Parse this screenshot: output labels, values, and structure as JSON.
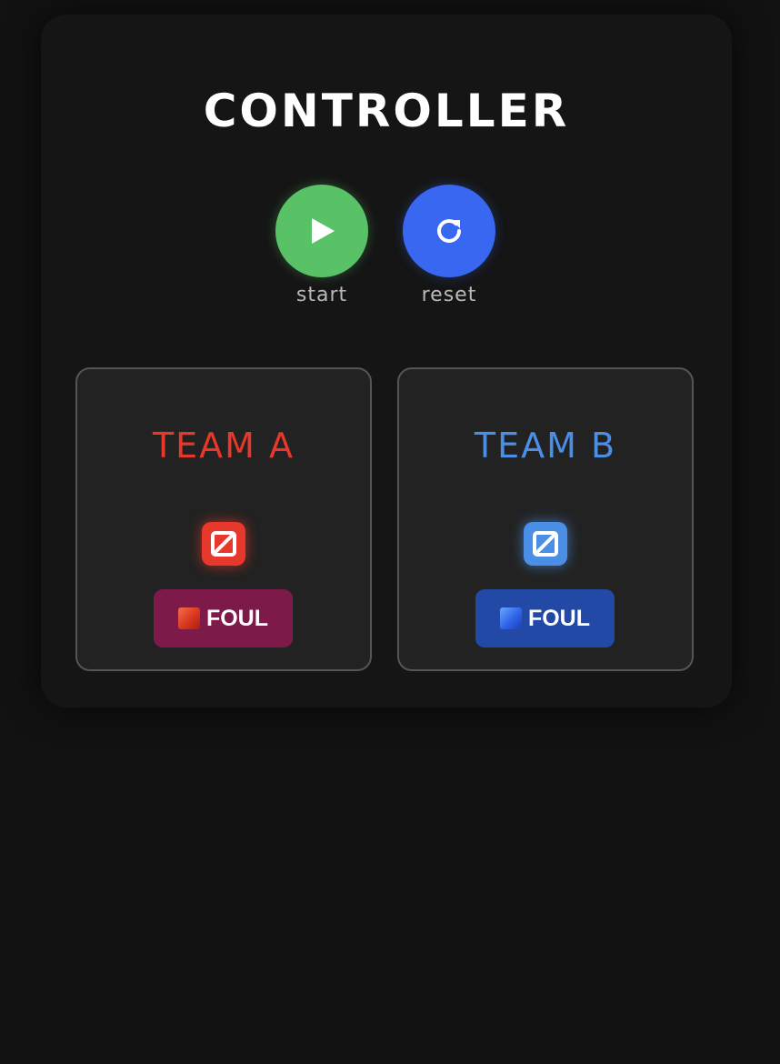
{
  "app": {
    "title": "CONTROLLER"
  },
  "controls": {
    "start": {
      "label": "start",
      "icon": "play-icon",
      "color": "#59c266"
    },
    "reset": {
      "label": "reset",
      "icon": "refresh-icon",
      "color": "#3867f2"
    }
  },
  "teams": [
    {
      "name": "TEAM A",
      "score": "0",
      "color": "#e8372b",
      "foul_label": "FOUL",
      "foul_icon": "red-square-icon",
      "foul_button_color": "#7d1a49"
    },
    {
      "name": "TEAM B",
      "score": "0",
      "color": "#4a8ee6",
      "foul_label": "FOUL",
      "foul_icon": "blue-square-icon",
      "foul_button_color": "#2249a5"
    }
  ]
}
